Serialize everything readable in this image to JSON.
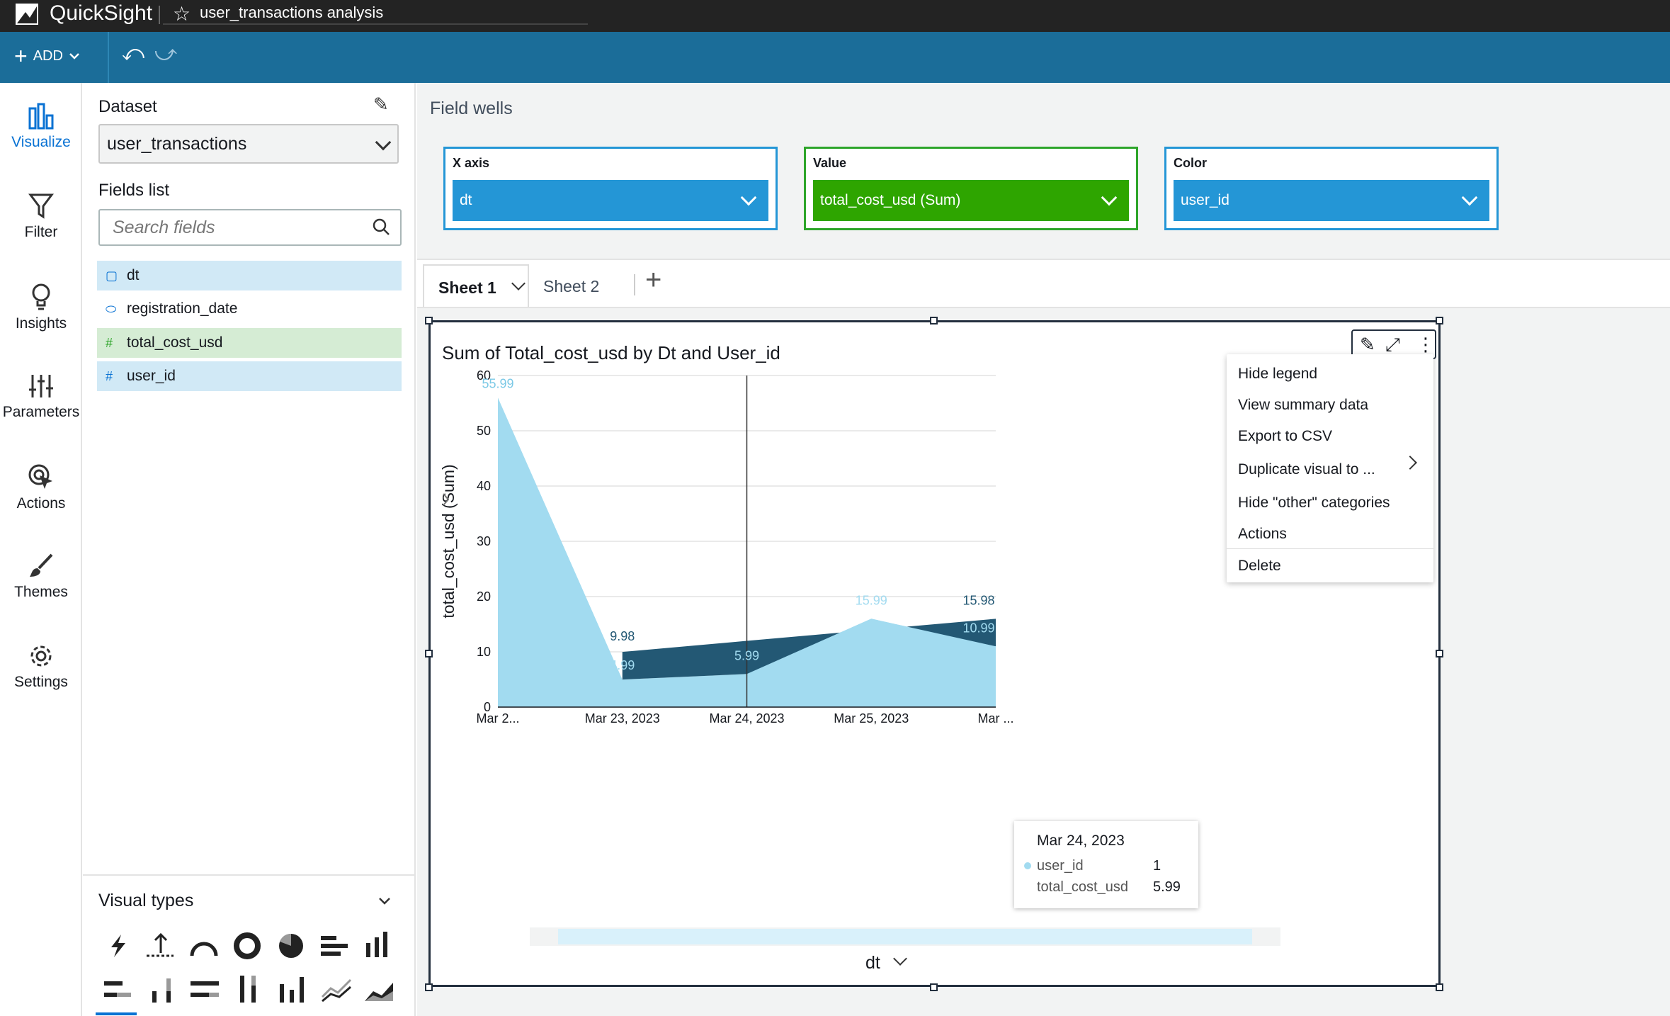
{
  "app": {
    "brand": "QuickSight",
    "analysis_title": "user_transactions analysis"
  },
  "toolbar": {
    "add_label": "ADD"
  },
  "nav": [
    {
      "label": "Visualize",
      "icon": "bar-chart-icon"
    },
    {
      "label": "Filter",
      "icon": "funnel-icon"
    },
    {
      "label": "Insights",
      "icon": "lightbulb-icon"
    },
    {
      "label": "Parameters",
      "icon": "sliders-icon"
    },
    {
      "label": "Actions",
      "icon": "cursor-click-icon"
    },
    {
      "label": "Themes",
      "icon": "brush-icon"
    },
    {
      "label": "Settings",
      "icon": "gear-icon"
    }
  ],
  "panel": {
    "dataset_title": "Dataset",
    "dataset_value": "user_transactions",
    "fields_title": "Fields list",
    "search_placeholder": "Search fields",
    "fields": [
      {
        "name": "dt",
        "type": "date",
        "state": "selected-blue"
      },
      {
        "name": "registration_date",
        "type": "text",
        "state": "none"
      },
      {
        "name": "total_cost_usd",
        "type": "measure",
        "state": "selected-green"
      },
      {
        "name": "user_id",
        "type": "measure",
        "state": "selected-blue"
      }
    ],
    "visual_types_title": "Visual types"
  },
  "field_wells": {
    "title": "Field wells",
    "x_axis": {
      "label": "X axis",
      "value": "dt"
    },
    "value": {
      "label": "Value",
      "value": "total_cost_usd (Sum)"
    },
    "color": {
      "label": "Color",
      "value": "user_id"
    }
  },
  "sheets": {
    "tab1": "Sheet 1",
    "tab2": "Sheet 2"
  },
  "visual": {
    "title": "Sum of Total_cost_usd by Dt and User_id",
    "menu": [
      "Hide legend",
      "View summary data",
      "Export to CSV",
      "Duplicate visual to ...",
      "Hide \"other\" categories",
      "Actions",
      "Delete"
    ],
    "tooltip": {
      "date": "Mar 24, 2023",
      "k1": "user_id",
      "v1": "1",
      "k2": "total_cost_usd",
      "v2": "5.99"
    },
    "x_field": "dt"
  },
  "chart_data": {
    "type": "area",
    "title": "Sum of Total_cost_usd by Dt and User_id",
    "xlabel": "dt",
    "ylabel": "total_cost_usd (Sum)",
    "categories": [
      "Mar 2...",
      "Mar 23, 2023",
      "Mar 24, 2023",
      "Mar 25, 2023",
      "Mar ..."
    ],
    "ylim": [
      0,
      60
    ],
    "yticks": [
      "0",
      "10",
      "20",
      "30",
      "40",
      "50",
      "60"
    ],
    "series": [
      {
        "values": [
          55.99,
          4.99,
          5.99,
          15.99,
          10.99
        ],
        "color": "#a2dbf0",
        "labels": [
          "55.99",
          "4.99",
          "5.99",
          "15.99",
          "10.99"
        ]
      },
      {
        "values": [
          null,
          9.98,
          11.98,
          13.98,
          15.98
        ],
        "color": "#235874",
        "labels": [
          "",
          "9.98",
          "",
          "",
          "15.98"
        ]
      }
    ],
    "stacked": false,
    "grid": true
  }
}
